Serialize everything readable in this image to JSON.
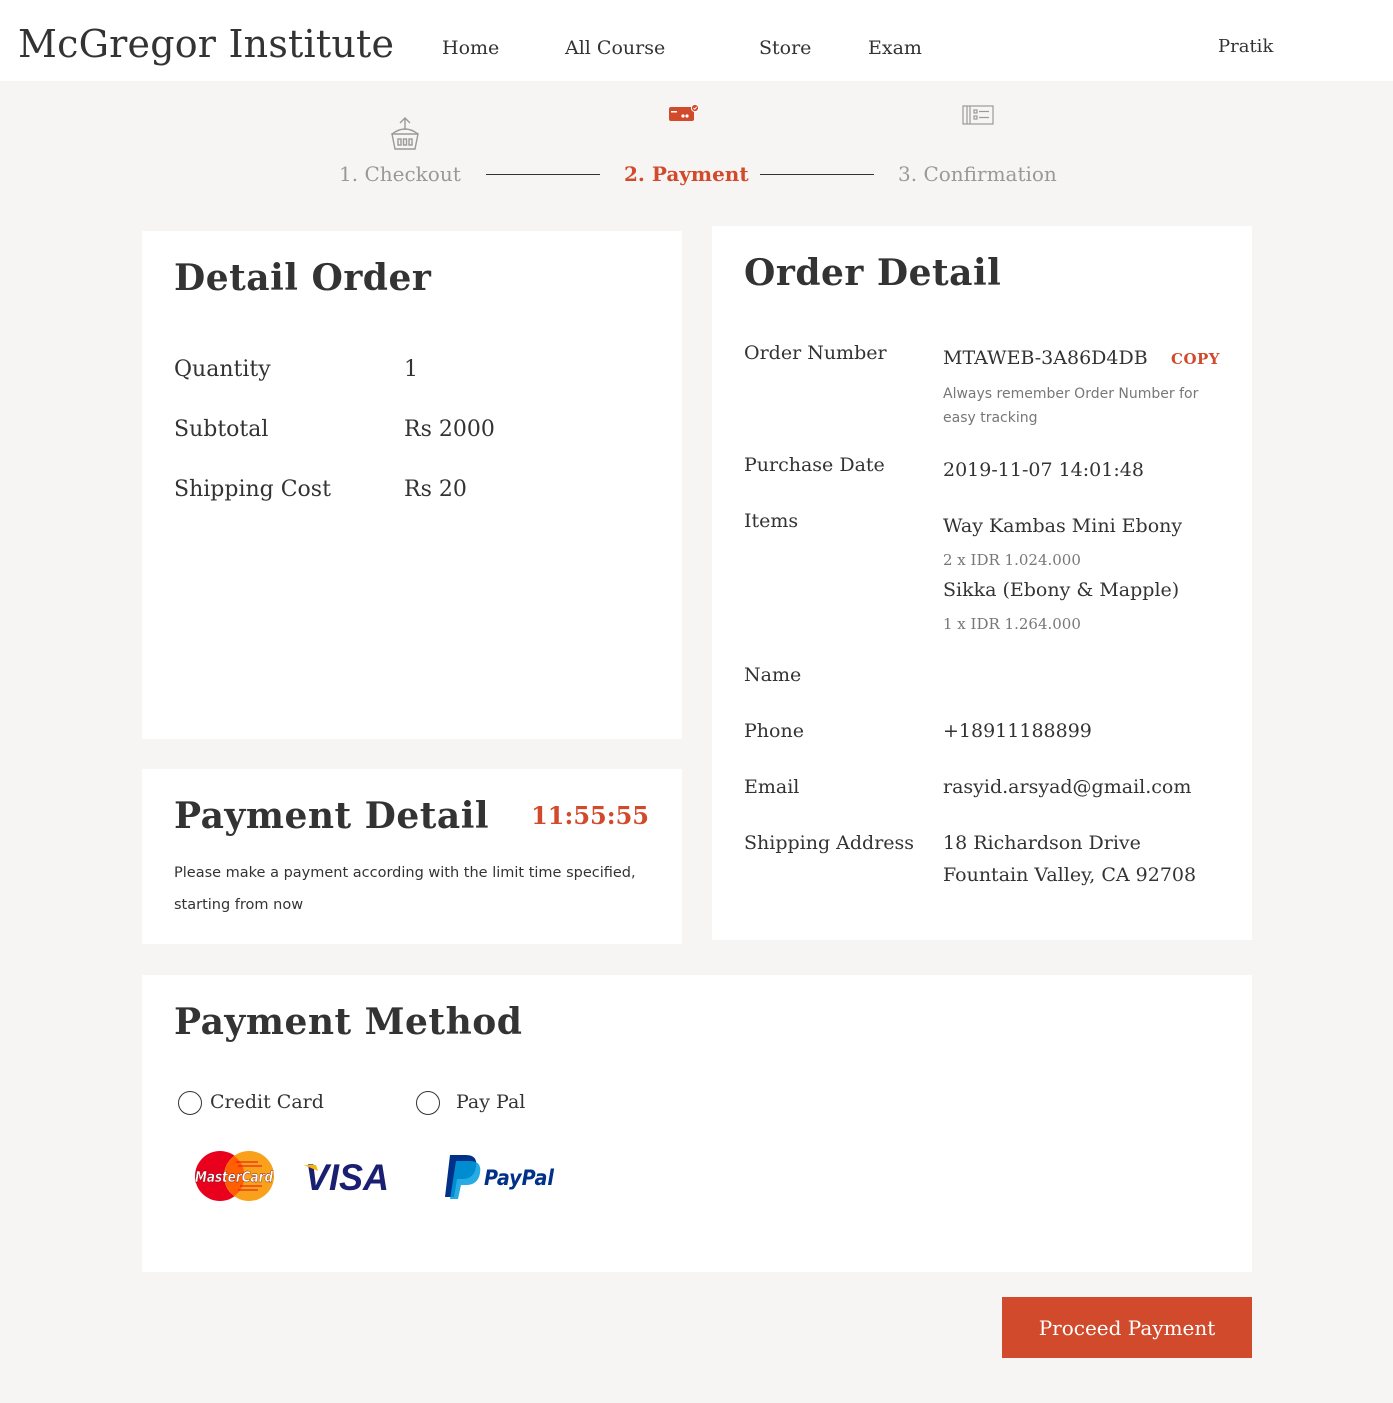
{
  "header": {
    "brand": "McGregor Institute",
    "nav": [
      "Home",
      "All Course",
      "Store",
      "Exam"
    ],
    "user": "Pratik"
  },
  "steps": {
    "items": [
      {
        "label": "1. Checkout",
        "icon": "basket-upload-icon",
        "state": "done"
      },
      {
        "label": "2. Payment",
        "icon": "card-payment-icon",
        "state": "active"
      },
      {
        "label": "3. Confirmation",
        "icon": "receipt-list-icon",
        "state": "pending"
      }
    ],
    "active_color": "#d14a2c"
  },
  "detail_order": {
    "title": "Detail Order",
    "rows": [
      {
        "label": "Quantity",
        "value": "1"
      },
      {
        "label": "Subtotal",
        "value": "Rs 2000"
      },
      {
        "label": "Shipping Cost",
        "value": "Rs 20"
      }
    ]
  },
  "payment_detail": {
    "title": "Payment Detail",
    "timer": "11:55:55",
    "note": "Please make a payment according with the limit time specified, starting from now"
  },
  "order_detail": {
    "title": "Order Detail",
    "order_number_label": "Order Number",
    "order_number": "MTAWEB-3A86D4DB",
    "copy_label": "COPY",
    "order_note": "Always remember Order Number for easy tracking",
    "purchase_date_label": "Purchase Date",
    "purchase_date": "2019-11-07 14:01:48",
    "items_label": "Items",
    "items": [
      {
        "name": "Way Kambas Mini Ebony",
        "qty_price": "2 x IDR 1.024.000"
      },
      {
        "name": "Sikka (Ebony & Mapple)",
        "qty_price": "1 x IDR 1.264.000"
      }
    ],
    "name_label": "Name",
    "name": "",
    "phone_label": "Phone",
    "phone": "+18911188899",
    "email_label": "Email",
    "email": "rasyid.arsyad@gmail.com",
    "address_label": "Shipping Address",
    "address_line1": "18 Richardson Drive",
    "address_line2": "Fountain Valley, CA 92708"
  },
  "payment_method": {
    "title": "Payment Method",
    "options": [
      {
        "label": "Credit Card",
        "selected": false
      },
      {
        "label": "Pay Pal",
        "selected": false
      }
    ],
    "logos": {
      "mastercard": "MasterCard",
      "visa": "VISA",
      "paypal": "PayPal"
    }
  },
  "proceed_label": "Proceed Payment",
  "colors": {
    "accent": "#d14a2c",
    "background": "#f6f5f3",
    "card": "#ffffff"
  }
}
